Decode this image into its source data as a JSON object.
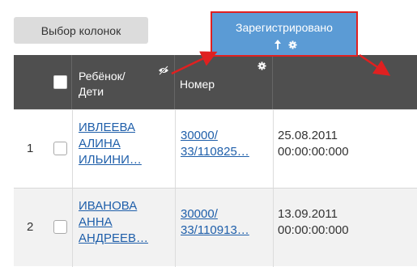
{
  "toolbar": {
    "columns_button": "Выбор колонок"
  },
  "header": {
    "child_col": {
      "line1": "Ребёнок/",
      "line2": "Дети"
    },
    "number_col": "Номер",
    "registered_col": "Зарегистрировано"
  },
  "rows": [
    {
      "num": "1",
      "child": [
        "ИВЛЕЕВА",
        "АЛИНА",
        "ИЛЬИНИ…"
      ],
      "number": [
        "30000/",
        "33/110825…"
      ],
      "date": [
        "25.08.2011",
        "00:00:00:000"
      ]
    },
    {
      "num": "2",
      "child": [
        "ИВАНОВА",
        "АННА",
        "АНДРЕЕВ…"
      ],
      "number": [
        "30000/",
        "33/110913…"
      ],
      "date": [
        "13.09.2011",
        "00:00:00:000"
      ]
    }
  ],
  "colors": {
    "header_bg": "#4f4f4f",
    "highlight": "#5b9bd5",
    "annotation": "#e02020",
    "link": "#1f5faa"
  },
  "icons": {
    "hide": "eye-slash-icon",
    "settings": "gear-icon",
    "sort": "arrow-up-icon"
  }
}
